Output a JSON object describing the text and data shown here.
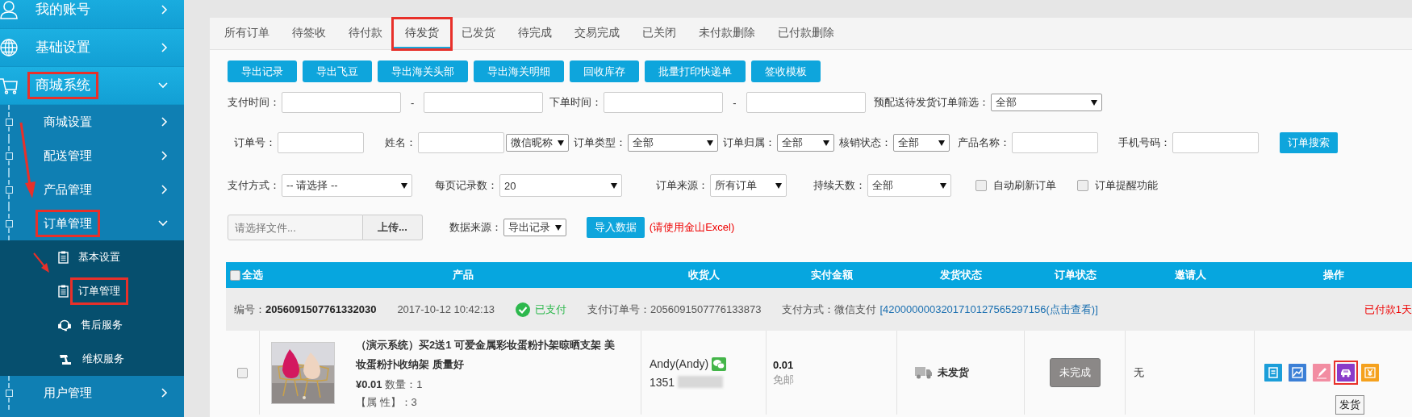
{
  "sidebar": {
    "items": [
      {
        "label": "我的账号",
        "kind": "user",
        "expanded": false,
        "highlighted": false
      },
      {
        "label": "基础设置",
        "kind": "globe",
        "expanded": false,
        "highlighted": false
      },
      {
        "label": "商城系统",
        "kind": "cart",
        "expanded": true,
        "highlighted": true,
        "children": [
          {
            "label": "商城设置",
            "expanded": false,
            "highlighted": false
          },
          {
            "label": "配送管理",
            "expanded": false,
            "highlighted": false
          },
          {
            "label": "产品管理",
            "expanded": false,
            "highlighted": false
          },
          {
            "label": "订单管理",
            "expanded": true,
            "highlighted": true,
            "children": [
              {
                "label": "基本设置",
                "kind": "clipboard",
                "highlighted": false
              },
              {
                "label": "订单管理",
                "kind": "clipboard",
                "highlighted": true
              },
              {
                "label": "售后服务",
                "kind": "headset",
                "highlighted": false
              },
              {
                "label": "维权服务",
                "kind": "hammer",
                "highlighted": false
              }
            ]
          },
          {
            "label": "用户管理",
            "expanded": false,
            "highlighted": false
          }
        ]
      }
    ],
    "annotations": [
      {
        "kind": "arrow"
      },
      {
        "kind": "arrow"
      }
    ]
  },
  "tabs": [
    {
      "label": "所有订单",
      "selected": false,
      "highlighted": false
    },
    {
      "label": "待签收",
      "selected": false,
      "highlighted": false
    },
    {
      "label": "待付款",
      "selected": false,
      "highlighted": false
    },
    {
      "label": "待发货",
      "selected": true,
      "highlighted": true
    },
    {
      "label": "已发货",
      "selected": false,
      "highlighted": false
    },
    {
      "label": "待完成",
      "selected": false,
      "highlighted": false
    },
    {
      "label": "交易完成",
      "selected": false,
      "highlighted": false
    },
    {
      "label": "已关闭",
      "selected": false,
      "highlighted": false
    },
    {
      "label": "未付款删除",
      "selected": false,
      "highlighted": false
    },
    {
      "label": "已付款删除",
      "selected": false,
      "highlighted": false
    }
  ],
  "toolbar": [
    "导出记录",
    "导出飞豆",
    "导出海关头部",
    "导出海关明细",
    "回收库存",
    "批量打印快递单",
    "签收模板"
  ],
  "filters": [
    [
      {
        "kind": "date-range",
        "label": "支付时间：",
        "separator": "-"
      },
      {
        "kind": "date-range",
        "label": "下单时间：",
        "separator": "-"
      },
      {
        "kind": "select",
        "label": "预配送待发货订单筛选：",
        "value": "全部"
      }
    ],
    [
      {
        "kind": "text",
        "label": "订单号："
      },
      {
        "kind": "text",
        "label": "姓名："
      },
      {
        "kind": "select",
        "value": "微信昵称"
      },
      {
        "kind": "select",
        "label": "订单类型：",
        "value": "全部"
      },
      {
        "kind": "select",
        "label": "订单归属：",
        "value": "全部"
      },
      {
        "kind": "select",
        "label": "核销状态：",
        "value": "全部"
      },
      {
        "kind": "text",
        "label": "产品名称："
      },
      {
        "kind": "text",
        "label": "手机号码："
      },
      {
        "kind": "button",
        "label": "订单搜索"
      }
    ],
    [
      {
        "kind": "select",
        "label": "支付方式：",
        "value": "-- 请选择 --"
      },
      {
        "kind": "select",
        "label": "每页记录数：",
        "value": "20"
      },
      {
        "kind": "select",
        "label": "订单来源：",
        "value": "所有订单"
      },
      {
        "kind": "select",
        "label": "持续天数：",
        "value": "全部"
      },
      {
        "kind": "checkbox",
        "label": "自动刷新订单",
        "checked": false
      },
      {
        "kind": "checkbox",
        "label": "订单提醒功能",
        "checked": false
      }
    ],
    [
      {
        "kind": "file",
        "placeholder": "请选择文件...",
        "button": "上传..."
      },
      {
        "kind": "select",
        "label": "数据来源：",
        "value": "导出记录"
      },
      {
        "kind": "button",
        "label": "导入数据"
      },
      {
        "kind": "note",
        "label": "(请使用金山Excel)"
      }
    ]
  ],
  "table": {
    "select_all": {
      "label": "全选",
      "checked": false
    },
    "columns": [
      "产品",
      "收货人",
      "实付金额",
      "发货状态",
      "订单状态",
      "邀请人",
      "操作"
    ],
    "orders": [
      {
        "checked": false,
        "number": "编号：**2056091507761332030**",
        "time": "2017-10-12 10:42:13",
        "pay_status": "已支付",
        "pay_order_no": "支付订单号：2056091507776133873",
        "pay_method": "支付方式：微信支付",
        "transaction_link": "[4200000003201710127565297156(点击查看)]",
        "paid_for": "已付款1天",
        "product": {
          "title": "（演示系统）买2送1 可爱金属彩妆蛋粉扑架晾晒支架 美妆蛋粉扑收纳架 质量好",
          "price": "¥0.01",
          "quantity": "数量：1",
          "attributes": "【属 性】：3"
        },
        "receiver": {
          "name": "Andy(Andy)",
          "phone": "1351"
        },
        "amount": "0.01",
        "shipping_fee": "免邮",
        "shipping_status": "未发货",
        "order_status": "未完成",
        "inviter": "无",
        "actions": [
          {
            "kind": "note",
            "color": "#1b9ed9",
            "highlighted": false
          },
          {
            "kind": "chart",
            "color": "#3b7fd6",
            "highlighted": false
          },
          {
            "kind": "pencil",
            "color": "#f28da2",
            "highlighted": false
          },
          {
            "kind": "car",
            "color": "#8a3bc9",
            "highlighted": true
          },
          {
            "kind": "yen",
            "color": "#f5a11d",
            "highlighted": false
          }
        ],
        "tooltip": "发货"
      }
    ]
  }
}
